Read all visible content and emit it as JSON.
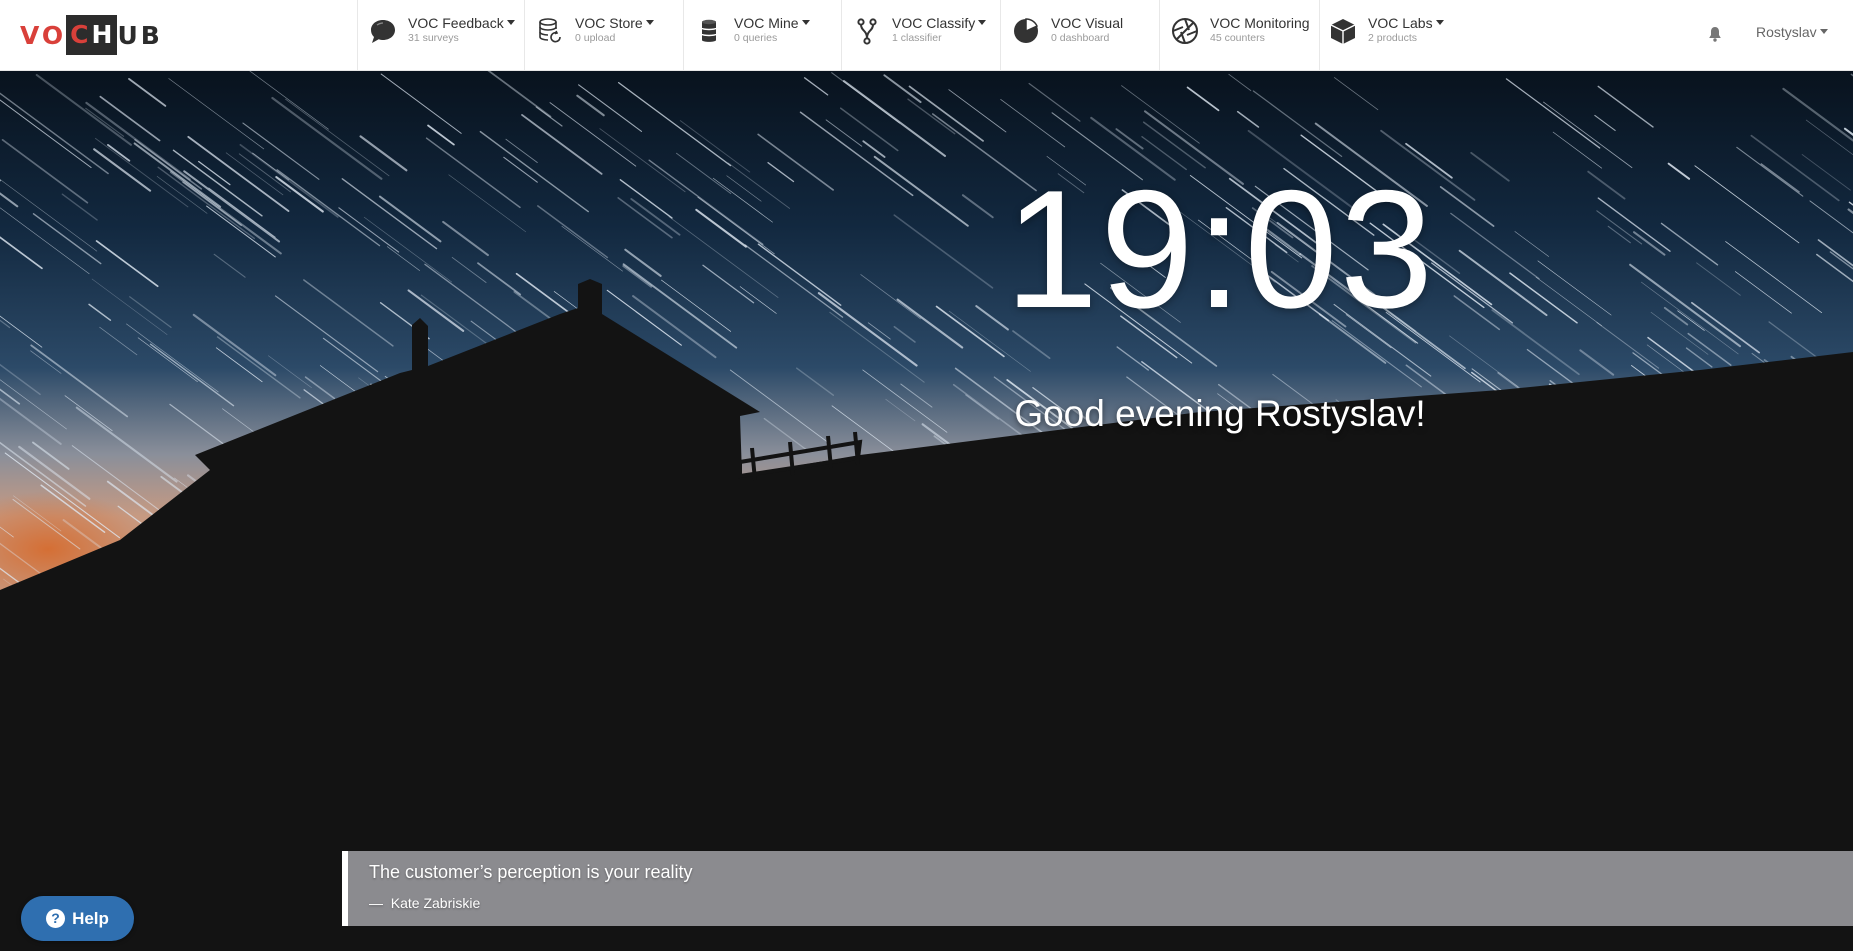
{
  "logo": {
    "part1": "VO",
    "part2": "C",
    "part3": "H",
    "part4": "UB",
    "accent": "#d9403a"
  },
  "nav": [
    {
      "label": "VOC Feedback",
      "sub": "31 surveys",
      "icon": "chat-bubble-icon",
      "dropdown": true
    },
    {
      "label": "VOC Store",
      "sub": "0 upload",
      "icon": "database-refresh-icon",
      "dropdown": true
    },
    {
      "label": "VOC Mine",
      "sub": "0 queries",
      "icon": "cylinder-icon",
      "dropdown": true
    },
    {
      "label": "VOC Classify",
      "sub": "1 classifier",
      "icon": "branch-fork-icon",
      "dropdown": true
    },
    {
      "label": "VOC Visual",
      "sub": "0 dashboard",
      "icon": "pie-chart-icon",
      "dropdown": false
    },
    {
      "label": "VOC Monitoring",
      "sub": "45 counters",
      "icon": "aperture-icon",
      "dropdown": false
    },
    {
      "label": "VOC Labs",
      "sub": "2 products",
      "icon": "cube-icon",
      "dropdown": true
    }
  ],
  "user": {
    "name": "Rostyslav"
  },
  "hero": {
    "time": "19:03",
    "greeting": "Good evening Rostyslav!"
  },
  "quote": {
    "text": "The customer’s perception is your reality",
    "dash": "—",
    "author": "Kate Zabriskie"
  },
  "help": {
    "label": "Help"
  }
}
